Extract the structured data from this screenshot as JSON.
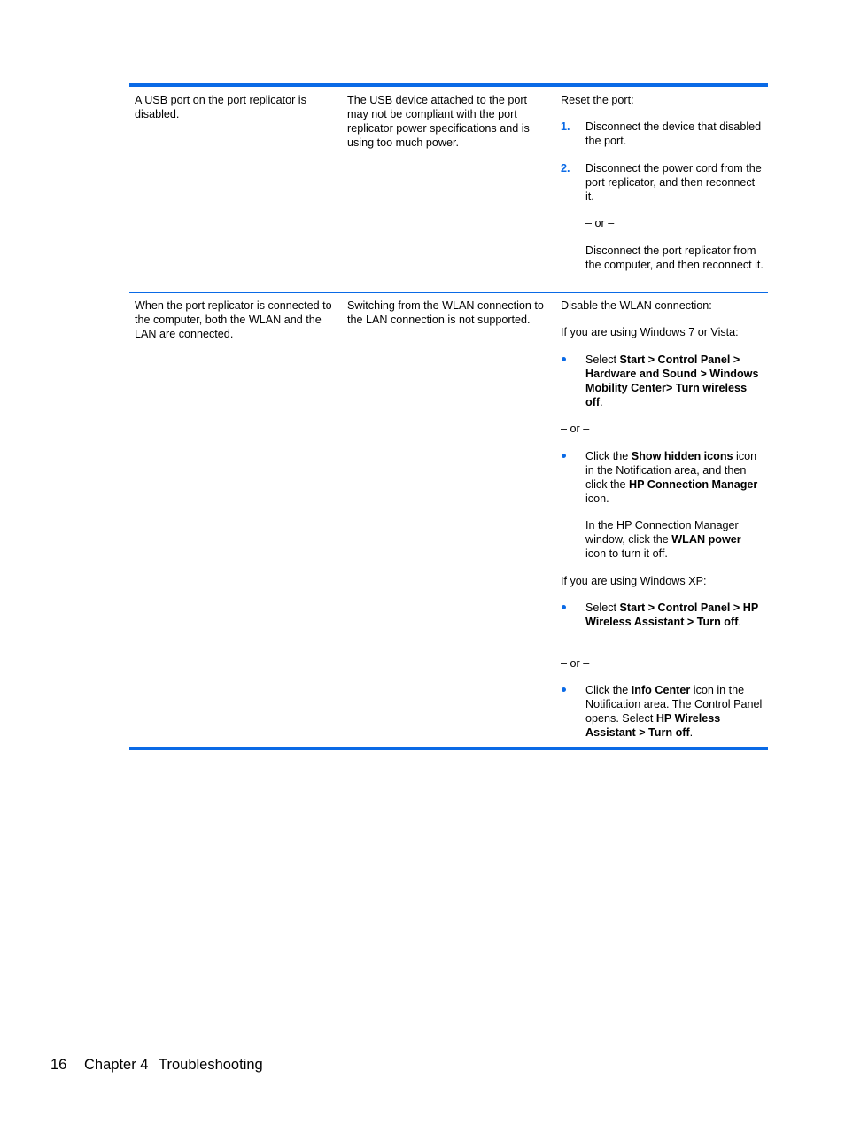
{
  "table": {
    "rows": [
      {
        "problem": "A USB port on the port replicator is disabled.",
        "cause": "The USB device attached to the port may not be compliant with the port replicator power specifications and is using too much power.",
        "solution": {
          "intro": "Reset the port:",
          "steps": [
            {
              "number": "1.",
              "text": "Disconnect the device that disabled the port."
            },
            {
              "number": "2.",
              "text": "Disconnect the power cord from the port replicator, and then reconnect it."
            }
          ],
          "or": "– or –",
          "alternative": "Disconnect the port replicator from the computer, and then reconnect it."
        }
      },
      {
        "problem": "When the port replicator is connected to the computer, both the WLAN and the LAN are connected.",
        "cause": "Switching from the WLAN connection to the LAN connection is not supported.",
        "solution": {
          "intro": "Disable the WLAN connection:",
          "win7_heading": "If you are using Windows 7 or Vista:",
          "win7_bullet1": {
            "prefix": "Select ",
            "bold": "Start > Control Panel > Hardware and Sound > Windows Mobility Center> Turn wireless off",
            "suffix": "."
          },
          "or1": "– or –",
          "win7_bullet2": {
            "t1": "Click the ",
            "b1": "Show hidden icons",
            "t2": " icon in the Notification area, and then click the ",
            "b2": "HP Connection Manager",
            "t3": " icon."
          },
          "win7_bullet2_para": {
            "t1": "In the HP Connection Manager window, click the ",
            "b1": "WLAN power",
            "t2": " icon to turn it off."
          },
          "xp_heading": "If you are using Windows XP:",
          "xp_bullet1": {
            "prefix": "Select ",
            "bold": "Start > Control Panel > HP Wireless Assistant > Turn off",
            "suffix": "."
          },
          "or2": "– or –",
          "xp_bullet2": {
            "t1": "Click the ",
            "b1": "Info Center",
            "t2": " icon in the Notification area. The Control Panel opens. Select ",
            "b2": "HP Wireless Assistant > Turn off",
            "t3": "."
          }
        }
      }
    ]
  },
  "footer": {
    "page_number": "16",
    "chapter": "Chapter 4",
    "title": "Troubleshooting"
  },
  "colors": {
    "accent": "#0a6ae6"
  }
}
